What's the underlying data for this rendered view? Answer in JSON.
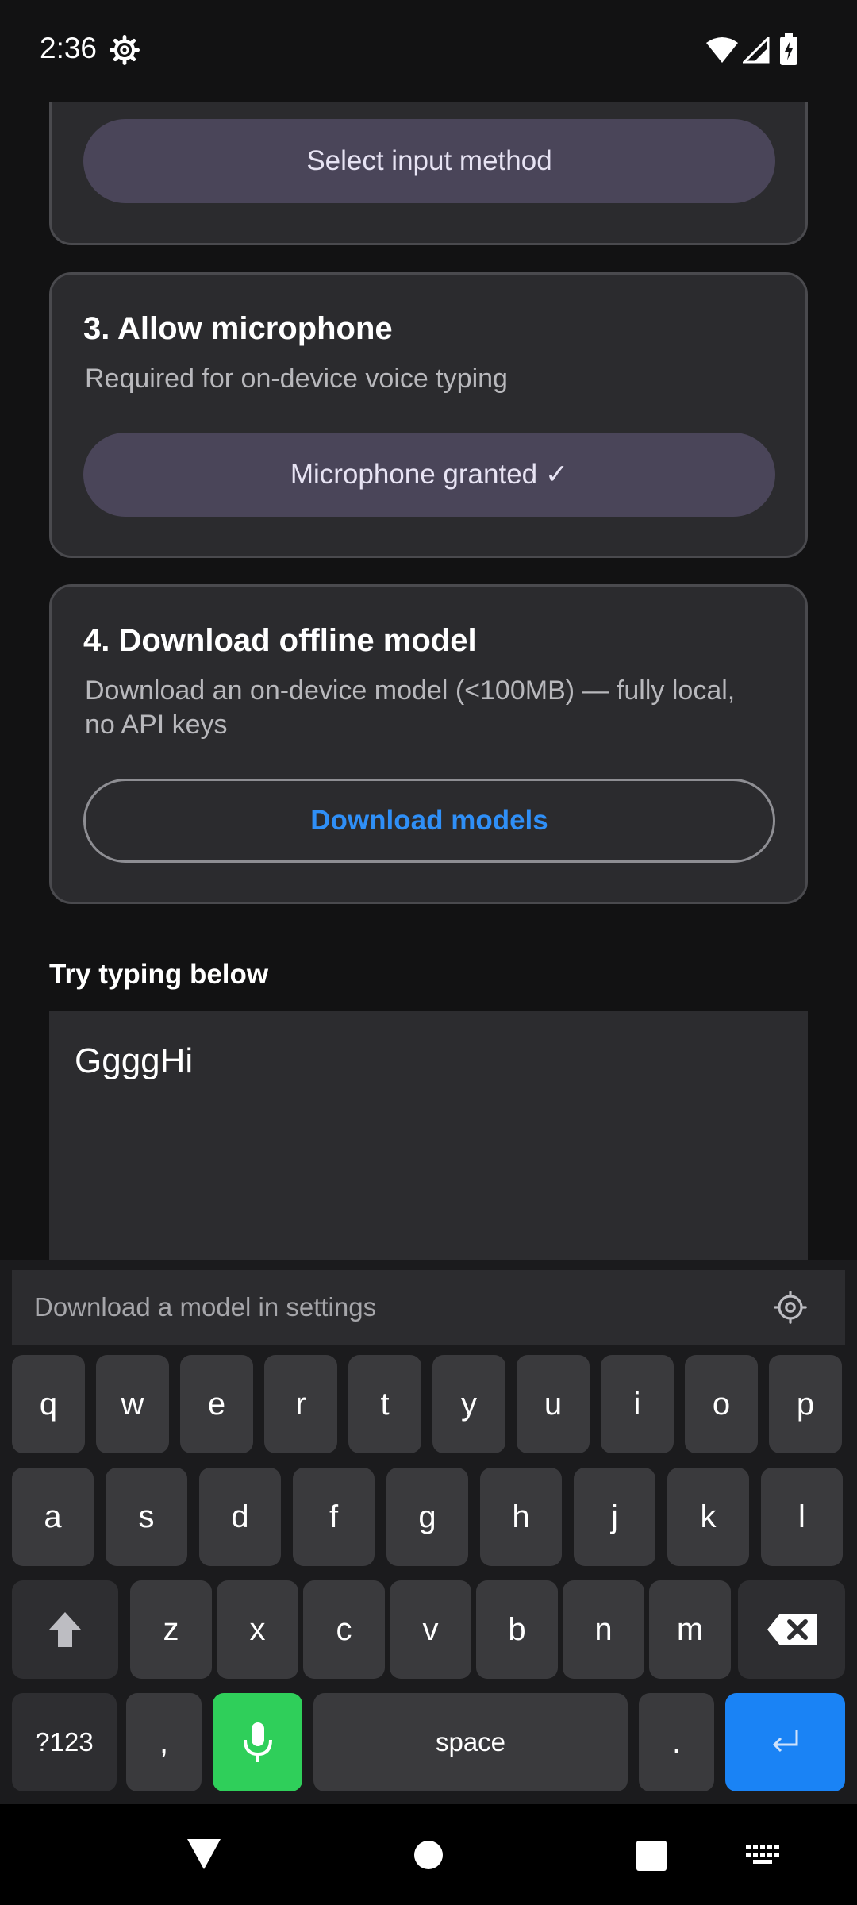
{
  "status_bar": {
    "time": "2:36",
    "icons": [
      "gear-icon",
      "wifi-icon",
      "signal-icon",
      "battery-charging-icon"
    ]
  },
  "cards": {
    "input_method": {
      "button_label": "Select input method"
    },
    "microphone": {
      "title": "3. Allow microphone",
      "description": "Required for on-device voice typing",
      "button_label": "Microphone granted ✓"
    },
    "model": {
      "title": "4. Download offline model",
      "description": "Download an on-device model (<100MB) — fully local, no API keys",
      "button_label": "Download models"
    }
  },
  "try_section": {
    "label": "Try typing below",
    "input_value": "GgggHi"
  },
  "keyboard": {
    "suggestion_text": "Download a model in settings",
    "row1": [
      "q",
      "w",
      "e",
      "r",
      "t",
      "y",
      "u",
      "i",
      "o",
      "p"
    ],
    "row2": [
      "a",
      "s",
      "d",
      "f",
      "g",
      "h",
      "j",
      "k",
      "l"
    ],
    "row3": [
      "z",
      "x",
      "c",
      "v",
      "b",
      "n",
      "m"
    ],
    "symbols_label": "?123",
    "comma": ",",
    "space_label": "space",
    "period": ".",
    "icons": [
      "shift-icon",
      "backspace-icon",
      "mic-icon",
      "enter-icon",
      "settings-icon"
    ]
  },
  "colors": {
    "accent_blue": "#1a83f5",
    "mic_green": "#2fcf5a",
    "tonal_button": "#4a4559",
    "link_blue": "#2f8ff7"
  },
  "nav_bar": {
    "icons": [
      "back-icon",
      "home-icon",
      "recents-icon",
      "keyboard-switch-icon"
    ]
  }
}
